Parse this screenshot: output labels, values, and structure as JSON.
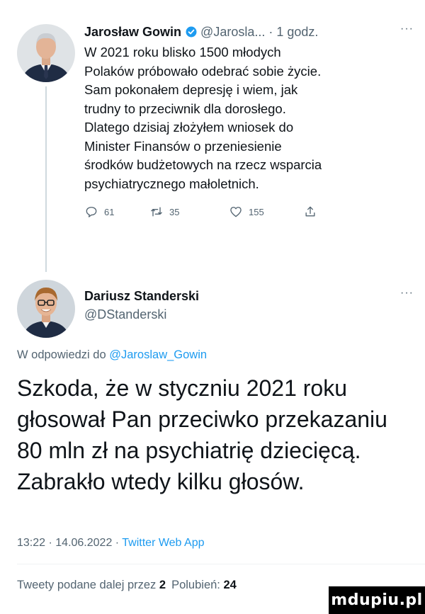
{
  "tweet": {
    "author_name": "Jarosław Gowin",
    "author_handle": "@Jarosla...",
    "time_separator": "·",
    "time": "1 godz.",
    "more": "···",
    "body": "W 2021 roku blisko 1500 młodych\nPolaków próbowało odebrać sobie życie.\nSam pokonałem depresję i wiem, jak\ntrudny to przeciwnik dla dorosłego.\nDlatego dzisiaj złożyłem wniosek do\nMinister Finansów o przeniesienie\nśrodków budżetowych na rzecz wsparcia\npsychiatrycznego małoletnich.",
    "reply_count": "61",
    "retweet_count": "35",
    "like_count": "155",
    "verified_color": "#1d9bf0"
  },
  "reply": {
    "author_name": "Dariusz Standerski",
    "author_handle": "@DStanderski",
    "more": "···",
    "replying_to_prefix": "W odpowiedzi do ",
    "replying_to_handle": "@Jaroslaw_Gowin",
    "body": "Szkoda, że w styczniu 2021 roku głosował Pan przeciwko przekazaniu 80 mln zł na psychiatrię dziecięcą. Zabrakło wtedy kilku głosów.",
    "time": "13:22",
    "sep1": " · ",
    "date": "14.06.2022",
    "sep2": " · ",
    "source": "Twitter Web App",
    "stats_prefix": "Tweety podane dalej przez ",
    "retweets": "2",
    "likes_label": "Polubień: ",
    "likes": "24"
  },
  "watermark": "mdupiu.pl",
  "colors": {
    "link": "#1d9bf0",
    "muted": "#536471",
    "text": "#0f1419"
  }
}
